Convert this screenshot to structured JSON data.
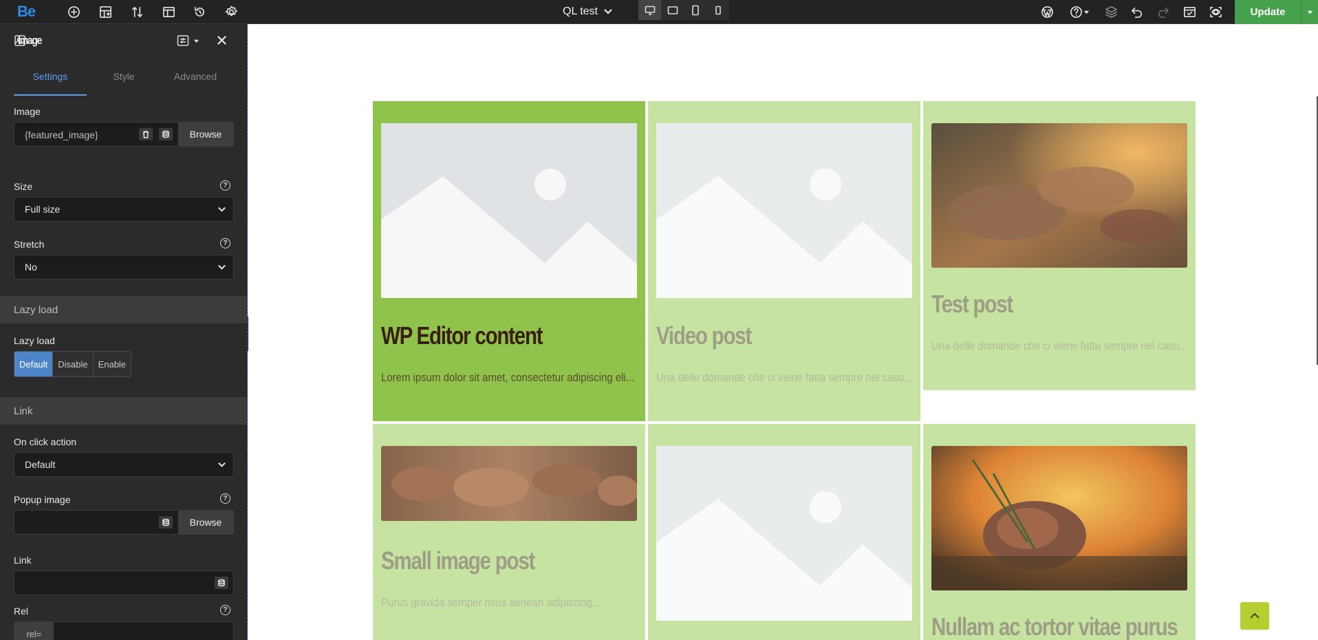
{
  "topbar": {
    "logo": "Be",
    "page_name": "QL test",
    "update_label": "Update",
    "icons": [
      "plus-circle-icon",
      "layout-add-icon",
      "sort-icon",
      "template-icon",
      "history-icon",
      "settings-icon"
    ],
    "devices": [
      "desktop-icon",
      "tablet-landscape-icon",
      "tablet-portrait-icon",
      "mobile-icon"
    ],
    "right_icons": [
      "wordpress-icon",
      "help-icon",
      "layers-icon",
      "undo-icon",
      "redo-icon",
      "preview-icon",
      "view-icon"
    ]
  },
  "panel": {
    "title": "Image",
    "tabs": [
      "Settings",
      "Style",
      "Advanced"
    ],
    "image_label": "Image",
    "image_value": "{featured_image}",
    "browse_label": "Browse",
    "size_label": "Size",
    "size_value": "Full size",
    "stretch_label": "Stretch",
    "stretch_value": "No",
    "lazy_section": "Lazy load",
    "lazy_label": "Lazy load",
    "lazy_options": [
      "Default",
      "Disable",
      "Enable"
    ],
    "link_section": "Link",
    "onclick_label": "On click action",
    "onclick_value": "Default",
    "popup_label": "Popup image",
    "popup_browse": "Browse",
    "link_label": "Link",
    "rel_label": "Rel",
    "rel_prefix": "rel="
  },
  "posts": [
    {
      "title": "WP Editor content",
      "excerpt": "Lorem ipsum dolor sit amet, consectetur adipiscing eli..."
    },
    {
      "title": "Video post",
      "excerpt": "Una delle domande che ci viene fatta sempre nel caso..."
    },
    {
      "title": "Test post",
      "excerpt": "Una delle domande che ci viene fatta sempre nel caso..."
    },
    {
      "title": "Small image post",
      "excerpt": "Purus gravida semper risus aenean adipiscing..."
    },
    {
      "title": "",
      "excerpt": ""
    },
    {
      "title": "Nullam ac tortor vitae purus",
      "excerpt": ""
    }
  ]
}
